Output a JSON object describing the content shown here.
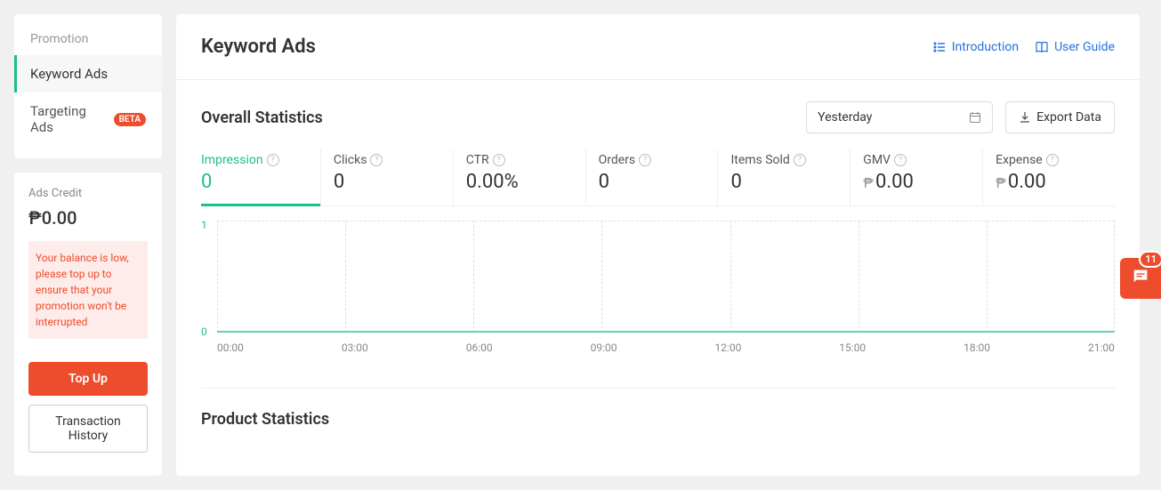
{
  "sidebar": {
    "section_title": "Promotion",
    "items": [
      {
        "label": "Keyword Ads",
        "active": true,
        "badge": null
      },
      {
        "label": "Targeting Ads",
        "active": false,
        "badge": "BETA"
      }
    ]
  },
  "credit": {
    "label": "Ads Credit",
    "amount": "₱0.00",
    "warning": "Your balance is low, please top up to ensure that your promotion won't be interrupted",
    "topup_label": "Top Up",
    "history_label": "Transaction History"
  },
  "header": {
    "title": "Keyword Ads",
    "introduction_label": "Introduction",
    "guide_label": "User Guide"
  },
  "stats": {
    "section_title": "Overall Statistics",
    "date_value": "Yesterday",
    "export_label": "Export Data",
    "metrics": [
      {
        "label": "Impression",
        "value": "0",
        "prefix": "",
        "active": true
      },
      {
        "label": "Clicks",
        "value": "0",
        "prefix": "",
        "active": false
      },
      {
        "label": "CTR",
        "value": "0.00%",
        "prefix": "",
        "active": false
      },
      {
        "label": "Orders",
        "value": "0",
        "prefix": "",
        "active": false
      },
      {
        "label": "Items Sold",
        "value": "0",
        "prefix": "",
        "active": false
      },
      {
        "label": "GMV",
        "value": "0.00",
        "prefix": "₱",
        "active": false
      },
      {
        "label": "Expense",
        "value": "0.00",
        "prefix": "₱",
        "active": false
      }
    ]
  },
  "chart_data": {
    "type": "line",
    "title": "",
    "xlabel": "",
    "ylabel": "",
    "ylim": [
      0,
      1
    ],
    "y_ticks": [
      "1",
      "0"
    ],
    "categories": [
      "00:00",
      "03:00",
      "06:00",
      "09:00",
      "12:00",
      "15:00",
      "18:00",
      "21:00"
    ],
    "series": [
      {
        "name": "Impression",
        "values": [
          0,
          0,
          0,
          0,
          0,
          0,
          0,
          0
        ]
      }
    ]
  },
  "product_stats": {
    "section_title": "Product Statistics"
  },
  "fab": {
    "badge": "11"
  }
}
